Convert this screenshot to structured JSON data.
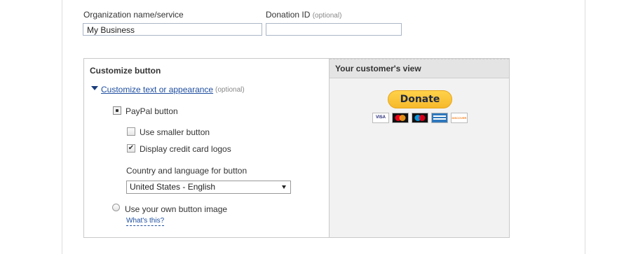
{
  "form": {
    "org_label": "Organization name/service",
    "org_value": "My Business",
    "donation_id_label": "Donation ID",
    "donation_id_optional": "(optional)",
    "donation_id_value": ""
  },
  "customize": {
    "title": "Customize button",
    "link_label": "Customize text or appearance",
    "link_optional": "(optional)",
    "paypal_button_label": "PayPal button",
    "paypal_button_selected": true,
    "smaller_button_label": "Use smaller button",
    "smaller_button_checked": false,
    "card_logos_label": "Display credit card logos",
    "card_logos_checked": true,
    "country_language_label": "Country and language for button",
    "country_language_value": "United States - English",
    "own_image_label": "Use your own button image",
    "own_image_selected": false,
    "whats_this": "What's this?"
  },
  "preview": {
    "header": "Your customer's view",
    "donate_label": "Donate",
    "cards": [
      {
        "name": "visa-icon",
        "text": "VISA",
        "color": "#1a1f71"
      },
      {
        "name": "mastercard-icon",
        "text": "",
        "color": "#eb001b"
      },
      {
        "name": "maestro-icon",
        "text": "",
        "color": "#0099df"
      },
      {
        "name": "amex-icon",
        "text": "",
        "color": "#2e77bc"
      },
      {
        "name": "discover-icon",
        "text": "DISCOVER",
        "color": "#f58220"
      }
    ]
  },
  "colors": {
    "link": "#1f4fa0",
    "donate_button": "#ffc439",
    "panel_border": "#c9c9c9"
  }
}
